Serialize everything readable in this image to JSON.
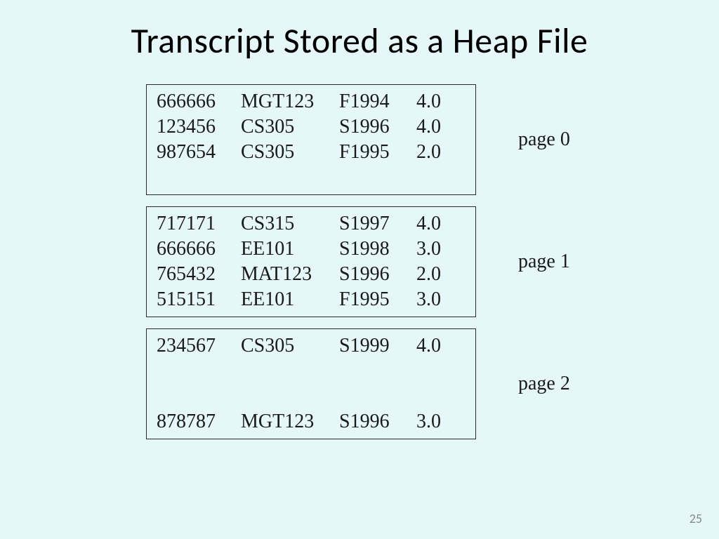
{
  "title": "Transcript Stored as a Heap File",
  "slide_number": "25",
  "pages": [
    {
      "label": "page 0",
      "slots": 4,
      "rows": [
        {
          "id": "666666",
          "course": "MGT123",
          "term": "F1994",
          "grade": "4.0"
        },
        {
          "id": "123456",
          "course": "CS305",
          "term": "S1996",
          "grade": "4.0"
        },
        {
          "id": "987654",
          "course": "CS305",
          "term": "F1995",
          "grade": "2.0"
        },
        null
      ]
    },
    {
      "label": "page 1",
      "slots": 4,
      "rows": [
        {
          "id": "717171",
          "course": "CS315",
          "term": "S1997",
          "grade": "4.0"
        },
        {
          "id": "666666",
          "course": "EE101",
          "term": "S1998",
          "grade": "3.0"
        },
        {
          "id": "765432",
          "course": "MAT123",
          "term": "S1996",
          "grade": "2.0"
        },
        {
          "id": "515151",
          "course": "EE101",
          "term": "F1995",
          "grade": "3.0"
        }
      ]
    },
    {
      "label": "page 2",
      "slots": 4,
      "rows": [
        {
          "id": "234567",
          "course": "CS305",
          "term": "S1999",
          "grade": "4.0"
        },
        null,
        null,
        {
          "id": "878787",
          "course": "MGT123",
          "term": "S1996",
          "grade": "3.0"
        }
      ]
    }
  ]
}
